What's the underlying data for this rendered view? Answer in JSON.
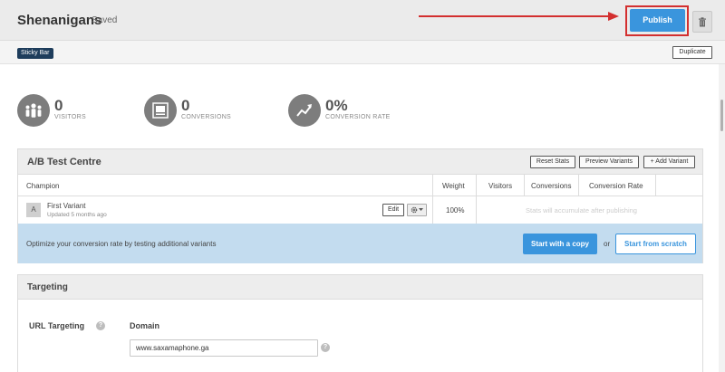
{
  "header": {
    "site_name": "Shenanigans",
    "save_status": "Saved",
    "publish_label": "Publish",
    "trash_icon": "trash-icon"
  },
  "subbar": {
    "type_badge": "Sticky Bar",
    "duplicate_label": "Duplicate"
  },
  "stats": [
    {
      "value": "0",
      "label": "VISITORS",
      "icon": "visitors-icon"
    },
    {
      "value": "0",
      "label": "CONVERSIONS",
      "icon": "conversions-icon"
    },
    {
      "value": "0%",
      "label": "CONVERSION RATE",
      "icon": "trend-icon"
    }
  ],
  "ab_test": {
    "title": "A/B Test Centre",
    "buttons": {
      "reset_stats": "Reset Stats",
      "preview_variants": "Preview Variants",
      "add_variant": "+ Add Variant"
    },
    "columns": [
      "Champion",
      "Weight",
      "Visitors",
      "Conversions",
      "Conversion Rate"
    ],
    "variants": [
      {
        "badge": "A",
        "name": "First Variant",
        "updated": "Updated 5 months ago",
        "edit_label": "Edit",
        "weight": "100%",
        "stats_note": "Stats will accumulate after publishing"
      }
    ],
    "promo": {
      "text": "Optimize your conversion rate by testing additional variants",
      "copy_label": "Start with a copy",
      "or_text": "or",
      "scratch_label": "Start from scratch"
    }
  },
  "targeting": {
    "title": "Targeting",
    "url_label": "URL Targeting",
    "domain_label": "Domain",
    "domain_value": "www.saxamaphone.ga",
    "help_glyph": "?"
  },
  "colors": {
    "accent_blue": "#3a95dd",
    "annotation_red": "#d32f2f",
    "promo_bg": "#c3dcef",
    "badge_navy": "#1e3d5c"
  }
}
